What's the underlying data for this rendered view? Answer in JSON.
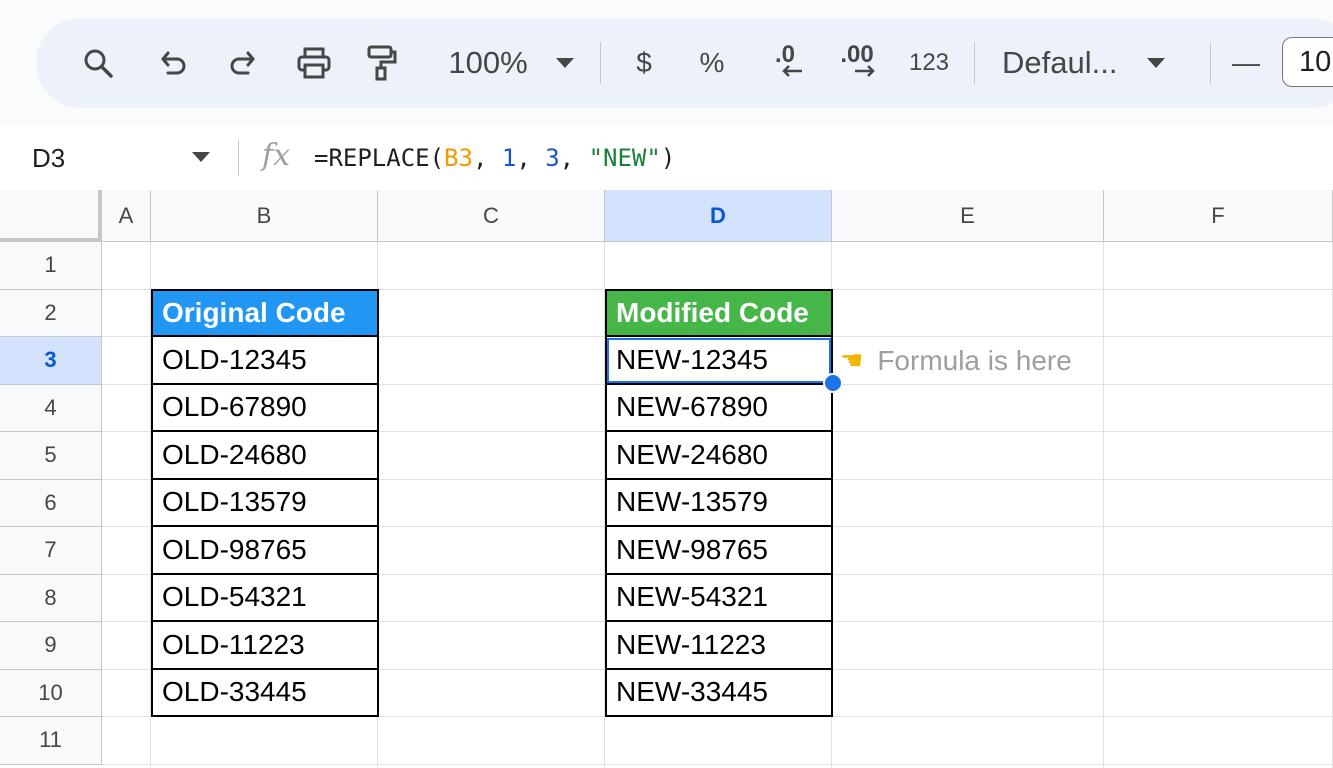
{
  "toolbar": {
    "zoom": "100%",
    "currency": "$",
    "percent": "%",
    "decrease_decimal": ".0",
    "increase_decimal": ".00",
    "number_format": "123",
    "font_family": "Defaul...",
    "decrease_font": "—",
    "font_size": "10"
  },
  "formula_bar": {
    "name_box": "D3",
    "fx_label": "fx",
    "formula": {
      "prefix": "=REPLACE(",
      "ref": "B3",
      "sep1": ", ",
      "arg2": "1",
      "sep2": ", ",
      "arg3": "3",
      "sep3": ", ",
      "arg4": "\"NEW\"",
      "suffix": ")"
    }
  },
  "columns": [
    "A",
    "B",
    "C",
    "D",
    "E",
    "F"
  ],
  "rows": [
    "1",
    "2",
    "3",
    "4",
    "5",
    "6",
    "7",
    "8",
    "9",
    "10",
    "11"
  ],
  "selected_cell": {
    "column": "D",
    "row": "3"
  },
  "sheet": {
    "original_header": "Original Code",
    "modified_header": "Modified Code",
    "original": [
      "OLD-12345",
      "OLD-67890",
      "OLD-24680",
      "OLD-13579",
      "OLD-98765",
      "OLD-54321",
      "OLD-11223",
      "OLD-33445"
    ],
    "modified": [
      "NEW-12345",
      "NEW-67890",
      "NEW-24680",
      "NEW-13579",
      "NEW-98765",
      "NEW-54321",
      "NEW-11223",
      "NEW-33445"
    ],
    "note_icon": "pointing-hand",
    "note": "Formula is here"
  },
  "colors": {
    "header_blue": "#2196f3",
    "header_green": "#46b649",
    "selection": "#1a73e8"
  }
}
